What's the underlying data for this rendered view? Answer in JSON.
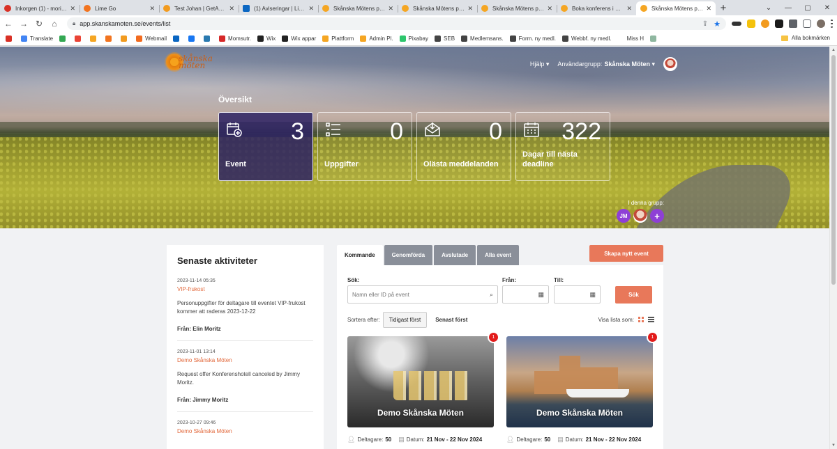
{
  "browser": {
    "tabs": [
      {
        "title": "Inkorgen (1) - moritz@",
        "color": "#d93025",
        "active": false
      },
      {
        "title": "Lime Go",
        "color": "#f2741f",
        "active": false
      },
      {
        "title": "Test Johan | GetAccept",
        "color": "#f29b1f",
        "active": false
      },
      {
        "title": "(1) Aviseringar | LinkedIn",
        "color": "#0a66c2",
        "active": false
      },
      {
        "title": "Skånska Mötens plattform",
        "color": "#f5a623",
        "active": false
      },
      {
        "title": "Skånska Mötens plattform",
        "color": "#f5a623",
        "active": false
      },
      {
        "title": "Skånska Mötens plattform",
        "color": "#f5a623",
        "active": false
      },
      {
        "title": "Boka konferens i Skåne",
        "color": "#f5a623",
        "active": false
      },
      {
        "title": "Skånska Mötens plattform",
        "color": "#f5a623",
        "active": true
      }
    ],
    "url": "app.skanskamoten.se/events/list",
    "bookmarks": [
      {
        "label": "",
        "color": "#d93025"
      },
      {
        "label": "Translate",
        "color": "#4285f4"
      },
      {
        "label": "",
        "color": "#34a853"
      },
      {
        "label": "",
        "color": "#ea4335"
      },
      {
        "label": "",
        "color": "#f5a623"
      },
      {
        "label": "",
        "color": "#f2741f"
      },
      {
        "label": "",
        "color": "#f29b1f"
      },
      {
        "label": "Webmail",
        "color": "#f26b1f"
      },
      {
        "label": "",
        "color": "#0a66c2"
      },
      {
        "label": "",
        "color": "#1877f2"
      },
      {
        "label": "",
        "color": "#2a7ab0"
      },
      {
        "label": "Momsutr.",
        "color": "#d62828"
      },
      {
        "label": "Wix",
        "color": "#222222"
      },
      {
        "label": "Wix appar",
        "color": "#222222"
      },
      {
        "label": "Plattform",
        "color": "#f5a623"
      },
      {
        "label": "Admin Pl.",
        "color": "#f5a623"
      },
      {
        "label": "Pixabay",
        "color": "#2ec66d"
      },
      {
        "label": "SEB",
        "color": "#444444"
      },
      {
        "label": "Medlemsans.",
        "color": "#444444"
      },
      {
        "label": "Form. ny medl.",
        "color": "#444444"
      },
      {
        "label": "Webbf. ny medl.",
        "color": "#444444"
      },
      {
        "label": "Miss H",
        "color": "#ffffff"
      },
      {
        "label": "",
        "color": "#8fb7a0"
      }
    ],
    "all_bookmarks": "Alla bokmärken"
  },
  "header": {
    "logo_line1": "skånska",
    "logo_line2": "möten",
    "help": "Hjälp",
    "usergroup_label": "Användargrupp:",
    "usergroup_value": "Skånska Möten"
  },
  "overview": {
    "title": "Översikt",
    "stats": [
      {
        "value": "3",
        "label": "Event"
      },
      {
        "value": "0",
        "label": "Uppgifter"
      },
      {
        "value": "0",
        "label": "Olästa meddelanden"
      },
      {
        "value": "322",
        "label": "Dagar till nästa deadline"
      }
    ],
    "group_label": "I denna grupp:",
    "group_initials": "JM",
    "group_add": "+"
  },
  "activities": {
    "title": "Senaste aktiviteter",
    "items": [
      {
        "timestamp": "2023-11-14 05:35",
        "link": "VIP-frukost",
        "message": "Personuppgifter för deltagare till eventet VIP-frukost kommer att raderas 2023-12-22",
        "from": "Från: Elin Moritz"
      },
      {
        "timestamp": "2023-11-01 13:14",
        "link": "Demo Skånska Möten",
        "message": "Request offer Konferenshotell canceled by Jimmy Moritz.",
        "from": "Från: Jimmy Moritz"
      },
      {
        "timestamp": "2023-10-27 09:46",
        "link": "Demo Skånska Möten",
        "message": "",
        "from": ""
      }
    ]
  },
  "events": {
    "tabs": [
      "Kommande",
      "Genomförda",
      "Avslutade",
      "Alla event"
    ],
    "create_button": "Skapa nytt event",
    "search_label": "Sök:",
    "search_placeholder": "Namn eller ID på event",
    "from_label": "Från:",
    "to_label": "Till:",
    "search_button": "Sök",
    "sort_label": "Sortera efter:",
    "sort_options": [
      "Tidigast först",
      "Senast först"
    ],
    "view_label": "Visa lista som:",
    "cards": [
      {
        "title": "Demo Skånska Möten",
        "badge": "1",
        "participants_label": "Deltagare:",
        "participants": "50",
        "date_label": "Datum:",
        "date": "21 Nov - 22 Nov 2024"
      },
      {
        "title": "Demo Skånska Möten",
        "badge": "1",
        "participants_label": "Deltagare:",
        "participants": "50",
        "date_label": "Datum:",
        "date": "21 Nov - 22 Nov 2024"
      }
    ]
  },
  "colors": {
    "accent": "#e8785a",
    "active_stat": "#2d2264",
    "link": "#e2683b",
    "badge": "#e21b1b",
    "avatar": "#8e3fd6"
  }
}
